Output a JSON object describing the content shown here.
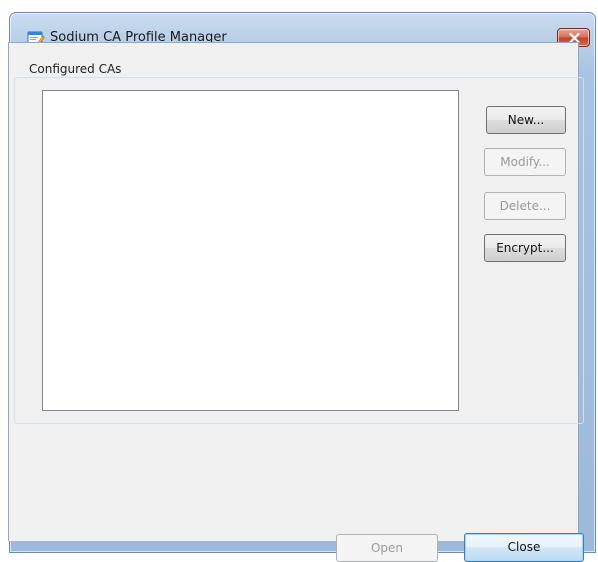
{
  "window": {
    "title": "Sodium CA Profile Manager",
    "title_icon": "app-icon",
    "close_icon": "close-icon",
    "close_color": "#c2432b"
  },
  "group": {
    "label": "Configured CAs",
    "list_items": []
  },
  "buttons": {
    "new_label": "New...",
    "modify_label": "Modify...",
    "delete_label": "Delete...",
    "encrypt_label": "Encrypt...",
    "open_label": "Open",
    "close_label": "Close"
  },
  "state": {
    "modify_enabled": false,
    "delete_enabled": false,
    "open_enabled": false,
    "default_button": "Close"
  }
}
